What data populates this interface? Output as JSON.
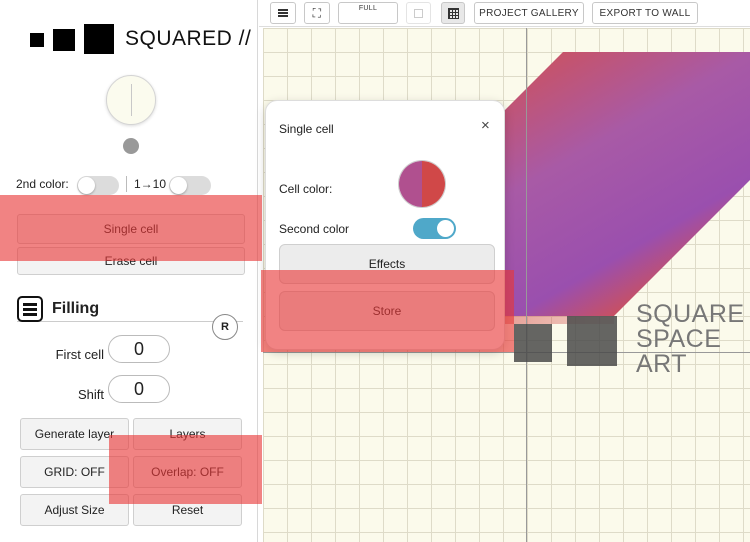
{
  "app": {
    "title": "SQUARED //"
  },
  "sidebar": {
    "toggles": {
      "second_color_label": "2nd color:",
      "range_label": "1→10"
    },
    "single_cell_label": "Single cell",
    "erase_cell_label": "Erase cell",
    "filling": {
      "title": "Filling",
      "reset_badge": "R",
      "first_cell_label": "First cell",
      "first_cell_value": "0",
      "shift_label": "Shift",
      "shift_value": "0"
    },
    "buttons": {
      "generate_layer": "Generate layer",
      "layers": "Layers",
      "grid": "GRID: OFF",
      "overlap": "Overlap: OFF",
      "adjust_size": "Adjust Size",
      "reset": "Reset"
    }
  },
  "toolbar": {
    "menu_icon": "menu-icon",
    "fullscreen_icon": "fullscreen-icon",
    "full_label": "FULL",
    "grid_icon": "grid-icon",
    "project_gallery": "PROJECT GALLERY",
    "export_to_wall": "EXPORT TO WALL"
  },
  "canvas": {
    "art_lines": [
      "SQUARE",
      "SPACE",
      "ART"
    ],
    "gradient_colors": [
      "#d4504e",
      "#a85aa6",
      "#9a4fae"
    ]
  },
  "popup": {
    "title": "Single cell",
    "close": "×",
    "cell_color_label": "Cell color:",
    "cell_colors": [
      "#b0508f",
      "#d04848"
    ],
    "second_color_label": "Second color",
    "second_color_on": true,
    "effects_label": "Effects",
    "store_label": "Store"
  },
  "colors": {
    "highlight": "#e83737",
    "toggle_on": "#4fa8c9"
  }
}
